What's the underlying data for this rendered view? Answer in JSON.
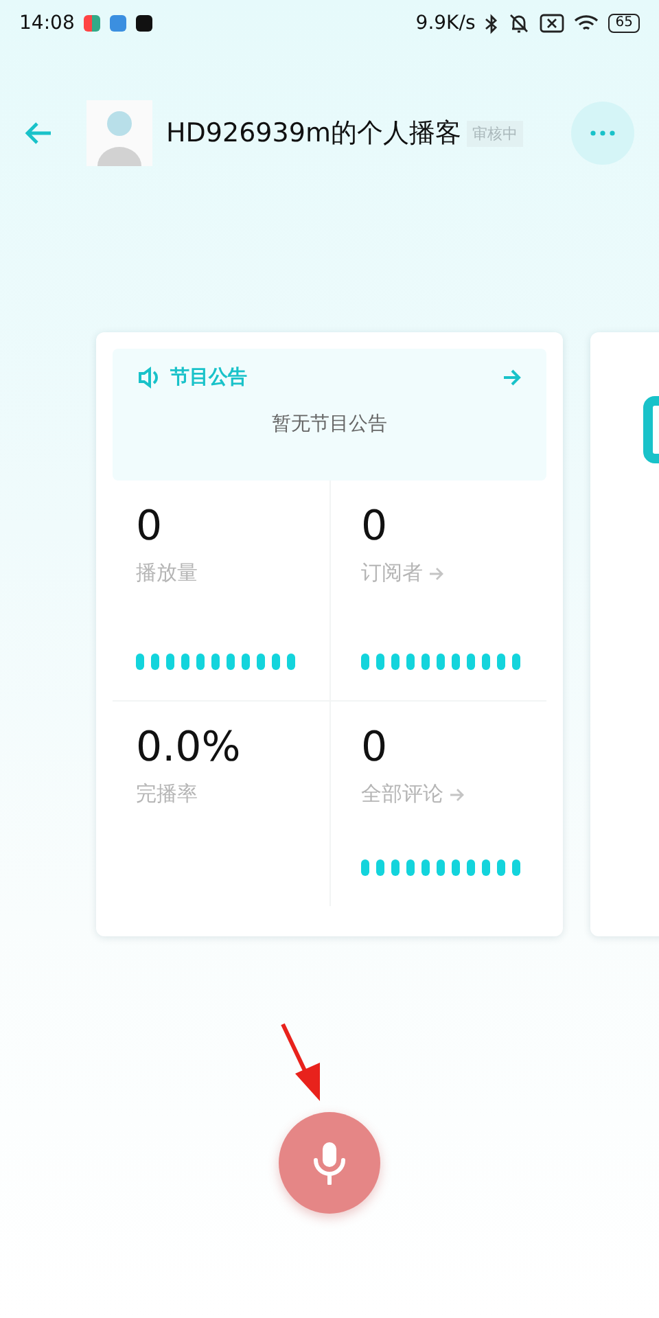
{
  "status_bar": {
    "time": "14:08",
    "speed": "9.9K/s",
    "battery": "65"
  },
  "header": {
    "title": "HD926939m的个人播客",
    "badge": "审核中"
  },
  "notice": {
    "title": "节目公告",
    "empty_text": "暂无节目公告"
  },
  "stats": [
    {
      "value": "0",
      "label": "播放量",
      "has_arrow": false,
      "wave": true
    },
    {
      "value": "0",
      "label": "订阅者",
      "has_arrow": true,
      "wave": true
    },
    {
      "value": "0.0%",
      "label": "完播率",
      "has_arrow": false,
      "wave": false
    },
    {
      "value": "0",
      "label": "全部评论",
      "has_arrow": true,
      "wave": true
    }
  ]
}
